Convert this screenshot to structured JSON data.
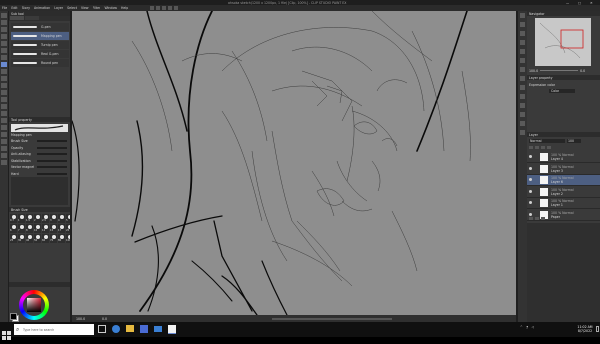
{
  "window": {
    "title": "ahsoka sketch(1200 x 1200px, 1 file) [Clip, 100%] - CLIP STUDIO PAINT EX",
    "controls": [
      "—",
      "□",
      "✕"
    ]
  },
  "menu": {
    "items": [
      "File",
      "Edit",
      "Story",
      "Animation",
      "Layer",
      "Select",
      "View",
      "Filter",
      "Window",
      "Help"
    ]
  },
  "tool_property": {
    "header": "Tool property",
    "brush_name": "Mapping pen",
    "fields": [
      "Brush Size",
      "Opacity",
      "Anti-aliasing",
      "Stabilization",
      "Vector magnet",
      "Hard"
    ],
    "size_value": "4.0"
  },
  "subtool": {
    "header": "Sub tool",
    "items": [
      "G-pen",
      "Mapping pen",
      "Turnip pen",
      "Real G-pen",
      "Round pen"
    ]
  },
  "brush_size": {
    "header": "Brush Size",
    "presets": [
      "0.7",
      "1",
      "1.5",
      "2",
      "2.5",
      "3",
      "4",
      "5",
      "6",
      "7",
      "8",
      "10",
      "12",
      "15",
      "17",
      "20",
      "25",
      "30",
      "40",
      "50",
      "60",
      "70",
      "80",
      "100"
    ]
  },
  "navigator": {
    "header": "Navigator",
    "zoom": "100.0",
    "angle": "0.0"
  },
  "layer_property": {
    "header": "Layer property",
    "expression_label": "Expression color",
    "expression_value": "Color"
  },
  "layers": {
    "header": "Layer",
    "blend_mode": "Normal",
    "opacity": "100",
    "items": [
      {
        "name": "Layer 4",
        "sub": "100 % Normal",
        "visible": true,
        "selected": false
      },
      {
        "name": "Layer 3",
        "sub": "100 % Normal",
        "visible": true,
        "selected": false
      },
      {
        "name": "Layer 6",
        "sub": "100 % Normal",
        "visible": true,
        "selected": true
      },
      {
        "name": "Layer 2",
        "sub": "100 % Normal",
        "visible": true,
        "selected": false
      },
      {
        "name": "Layer 1",
        "sub": "100 % Normal",
        "visible": true,
        "selected": false
      },
      {
        "name": "Paper",
        "sub": "100 % Normal",
        "visible": true,
        "selected": false
      }
    ]
  },
  "canvas_status": {
    "zoom": "100.0",
    "angle": "0.0"
  },
  "taskbar": {
    "search_placeholder": "Type here to search",
    "time": "11:02 AM",
    "date": "8/7/2022"
  },
  "colors": {
    "canvas": "#8e8e8e",
    "panel": "#3a3a3a",
    "accent": "#6a8ad0",
    "main_color": "#000000",
    "sub_color": "#ffffff"
  }
}
